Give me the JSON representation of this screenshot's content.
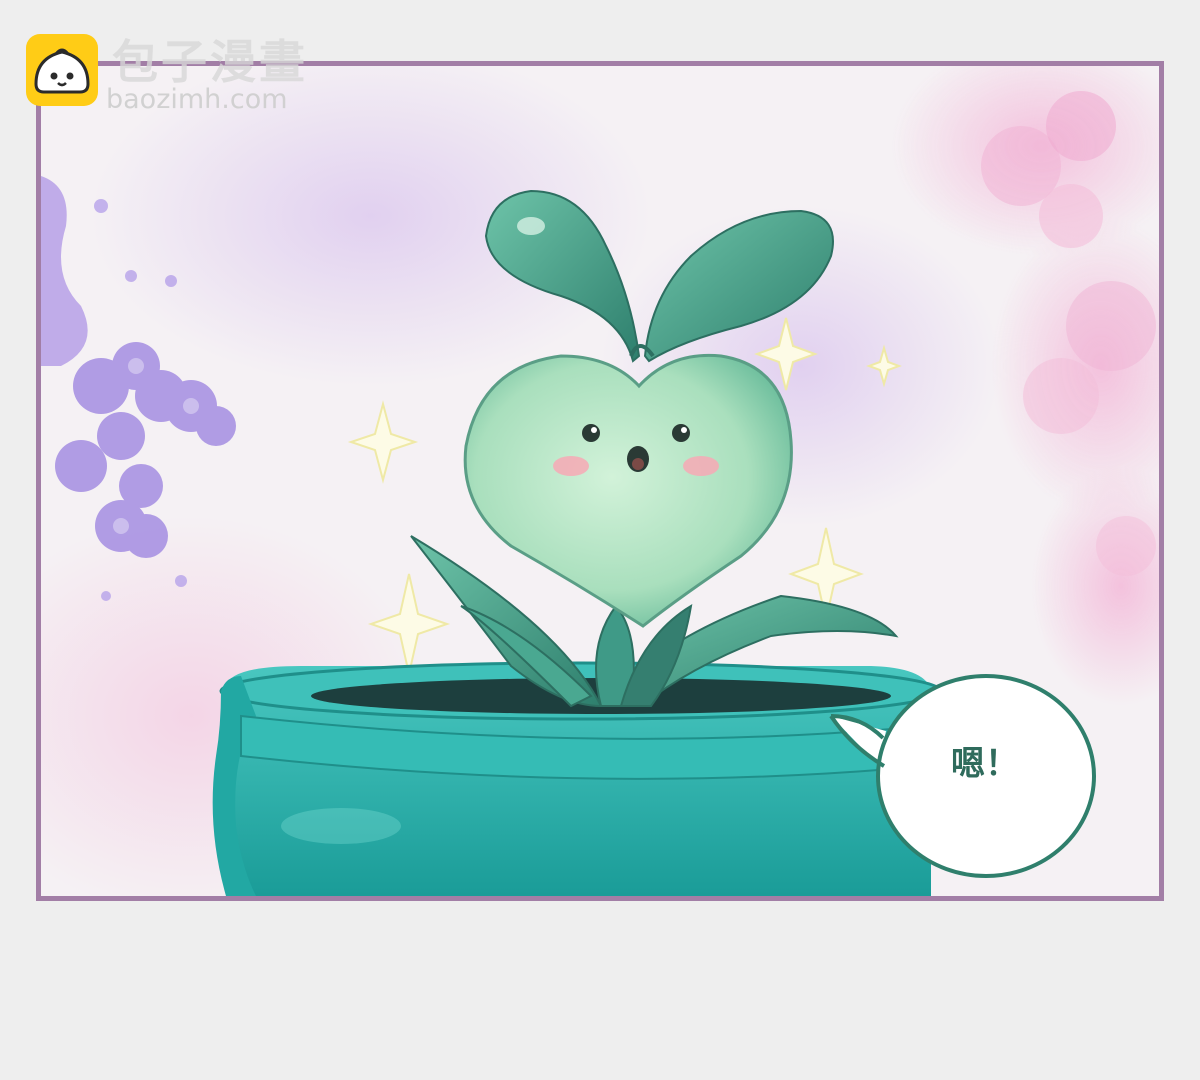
{
  "watermark": {
    "site_name": "包子漫畫",
    "url": "baozimh.com",
    "logo_icon": "bun-mascot-icon",
    "logo_color": "#ffcc16"
  },
  "panel": {
    "border_color": "#a27ea6",
    "speech_bubble": {
      "text": "嗯！"
    }
  },
  "colors": {
    "sprout_leaf": "#3f9a87",
    "sprout_body": "#b8e6c4",
    "pot": "#2bb3ae",
    "flower_purple": "#a78fe0",
    "flower_pink": "#f0a9cf",
    "bubble_border": "#2f7f6c"
  }
}
